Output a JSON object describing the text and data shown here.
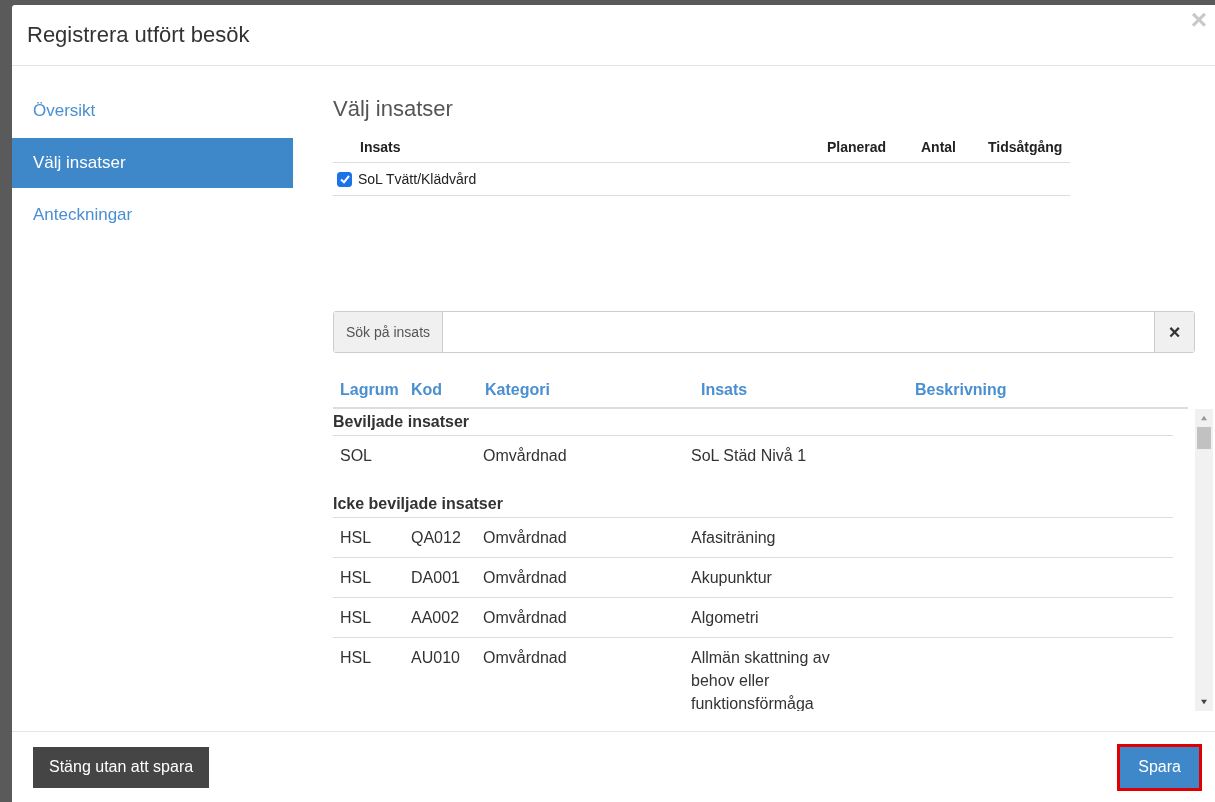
{
  "window": {
    "title": "Registrera utfört besök",
    "close": "×"
  },
  "sidebar": {
    "items": [
      {
        "label": "Översikt",
        "selected": false
      },
      {
        "label": "Välj insatser",
        "selected": true
      },
      {
        "label": "Anteckningar",
        "selected": false
      }
    ]
  },
  "selected_section": {
    "heading": "Välj insatser",
    "columns": [
      "Insats",
      "Planerad",
      "Antal",
      "Tidsåtgång"
    ],
    "rows": [
      {
        "label": "SoL Tvätt/Klädvård",
        "checked": true
      }
    ]
  },
  "search": {
    "label": "Sök på insats",
    "clear": "×"
  },
  "results": {
    "columns": [
      "Lagrum",
      "Kod",
      "Kategori",
      "Insats",
      "Beskrivning"
    ],
    "groups": [
      {
        "title": "Beviljade insatser",
        "rows": [
          {
            "lagrum": "SOL",
            "kod": "",
            "kategori": "Omvårdnad",
            "insats": "SoL Städ Nivå 1"
          }
        ]
      },
      {
        "title": "Icke beviljade insatser",
        "rows": [
          {
            "lagrum": "HSL",
            "kod": "QA012",
            "kategori": "Omvårdnad",
            "insats": "Afasiträning"
          },
          {
            "lagrum": "HSL",
            "kod": "DA001",
            "kategori": "Omvårdnad",
            "insats": "Akupunktur"
          },
          {
            "lagrum": "HSL",
            "kod": "AA002",
            "kategori": "Omvårdnad",
            "insats": "Algometri"
          },
          {
            "lagrum": "HSL",
            "kod": "AU010",
            "kategori": "Omvårdnad",
            "insats": "Allmän skattning av behov eller funktionsförmåga"
          }
        ]
      }
    ]
  },
  "footer": {
    "buttons": [
      {
        "label": "Stäng utan att spara",
        "kind": "dark",
        "highlighted": false
      },
      {
        "label": "Spara",
        "kind": "primary",
        "highlighted": true
      }
    ]
  }
}
